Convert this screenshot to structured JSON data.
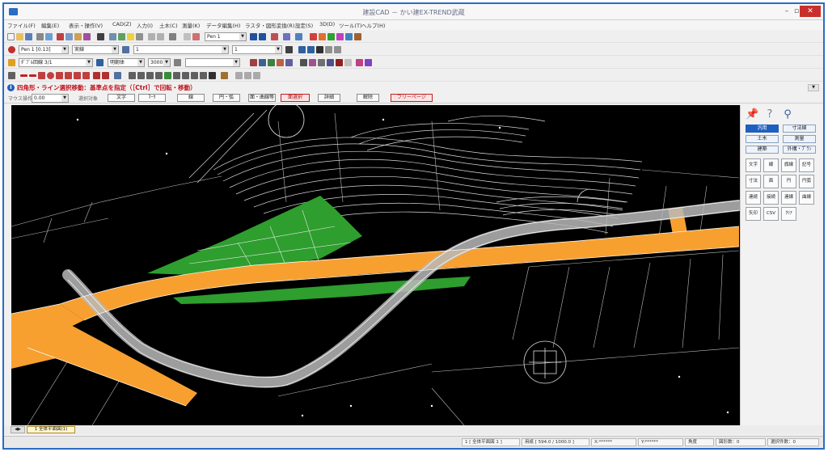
{
  "window": {
    "title": "建設CAD － かい建EX-TREND武蔵",
    "minimize": "–",
    "maximize": "▫",
    "close": "✕"
  },
  "menu": [
    "ファイル(F)",
    "編集(E)",
    "表示・操作(V)",
    "CAD(Z)",
    "入力(I)",
    "土木(C)",
    "測量(K)",
    "データ編集(H)",
    "ラスタ・図形変換(R)",
    "設定(S)",
    "3D(D)",
    "ツール(T)",
    "ヘルプ(H)"
  ],
  "toolbar_combos": {
    "pen": "Pen 1 [0.13]",
    "linetype": "実線",
    "layer_main": "1",
    "layer_sub": "1",
    "style": "ﾀﾞﾌﾞﾙ回線 3/1",
    "text_style": "明朝体",
    "size": "3000",
    "paper": "Pen 1"
  },
  "prompt": {
    "icon": "i",
    "text": "四角形・ライン選択移動：基準点を指定（［Ctrl］で回転・移動）"
  },
  "option_bar": {
    "label": "マウス操作",
    "value": "0.00",
    "mode_label": "選択対象",
    "buttons": [
      "文字",
      "ﾏｰｸ",
      "線",
      "円・弧",
      "面・曲線等",
      "面選択",
      "詳細",
      "解除"
    ],
    "favorite": "フリーページ"
  },
  "side_panel": {
    "top_icons": [
      "push-pin",
      "help",
      "search"
    ],
    "categories": [
      "汎用",
      "寸法線",
      "土木",
      "測量",
      "建築",
      "外構・ﾌﾟﾗﾝ"
    ],
    "tools": [
      "文字",
      "線",
      "旗線",
      "記号",
      "寸法",
      "面",
      "円",
      "円弧",
      "連続",
      "接続",
      "連線",
      "曲線",
      "矢印",
      "CSV",
      "ｸﾘｱ"
    ]
  },
  "sheet_tab": {
    "label": "1 全体平面図(1)",
    "nav": "◀▶"
  },
  "status_bar": {
    "cells": [
      "1 [ 全体平面図 1 ]",
      "用紙 [ 594.0 / 1000.0 ]",
      "X:******",
      "Y:******",
      "角度",
      "図形数：0",
      "選択件数：0"
    ]
  },
  "colors": {
    "titlebar_accent": "#2b6cc4",
    "road_orange": "#f7a030",
    "vegetation_green": "#2e9e2e",
    "road_gray": "#b8b8b8",
    "canvas_bg": "#000000",
    "prompt_red": "#c0101a",
    "active_blue": "#1f5fbf"
  }
}
